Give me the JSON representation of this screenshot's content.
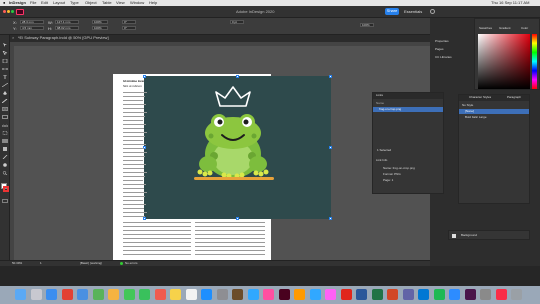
{
  "menubar": {
    "app_name": "InDesign",
    "menus": [
      "File",
      "Edit",
      "Layout",
      "Type",
      "Object",
      "Table",
      "View",
      "Window",
      "Help"
    ],
    "clock": "Thu 16 Sep 11:17 AM"
  },
  "appbar": {
    "title": "Adobe InDesign 2020",
    "share_label": "Share",
    "workspace_label": "Essentials",
    "search_icon": "search-icon"
  },
  "control": {
    "x_label": "X:",
    "x_value": "28.3 mm",
    "y_label": "Y:",
    "y_value": "4.5 mm",
    "w_label": "W:",
    "w_value": "127.1 mm",
    "h_label": "H:",
    "h_value": "98.02 mm",
    "scale_x": "100%",
    "scale_y": "100%",
    "angle": "0°",
    "shear": "0°",
    "stroke": "0 pt",
    "zoom_pct": "100%"
  },
  "tab": {
    "label": "*El Subway Paragraph.indd @ 50% [GPU Preview]",
    "close": "×"
  },
  "document": {
    "heading": "Id minime lorem",
    "paragraph_visible": "Sint ut rubrum",
    "graphic_desc": "Cartoon frog with crown"
  },
  "status": {
    "zoom": "50.39%",
    "page": "1",
    "style": "[Basic] (working)",
    "errors": "No errors"
  },
  "panels": {
    "tabs": [
      "Properties",
      "Pages",
      "CC Libraries"
    ],
    "color_tabs": [
      "Swatches",
      "Gradient",
      "Color"
    ],
    "links": {
      "title": "Links",
      "name_header": "Name",
      "item": "frog-on-crop.png",
      "selected_count": "1 Selected",
      "link_info_title": "Link Info",
      "info_name": "Name: frog-on-crop.png",
      "info_format": "Format: PNG",
      "info_page": "Page: 1"
    },
    "char_styles": {
      "tabs": [
        "Character Styles",
        "Paragraph"
      ],
      "header": "No Style",
      "items": [
        "[None]",
        "Bold Italic Large"
      ]
    },
    "layers": {
      "item": "Background"
    }
  },
  "dock": {
    "apps": [
      "finder",
      "launchpad",
      "safari",
      "chrome",
      "mail",
      "maps",
      "photos",
      "messages",
      "facetime",
      "calendar",
      "notes",
      "reminders",
      "appstore",
      "settings",
      "bridge",
      "lightroom",
      "incopy",
      "indesign",
      "illustrator",
      "photoshop",
      "xd",
      "acrobat",
      "word",
      "excel",
      "powerpoint",
      "teams",
      "outlook",
      "spotify",
      "zoom",
      "slack",
      "files",
      "music",
      "trash"
    ]
  },
  "colors": {
    "accent": "#2680eb",
    "frog_green": "#8cc63f",
    "frame_bg": "#2e4a4c",
    "crown": "#ffffff"
  }
}
